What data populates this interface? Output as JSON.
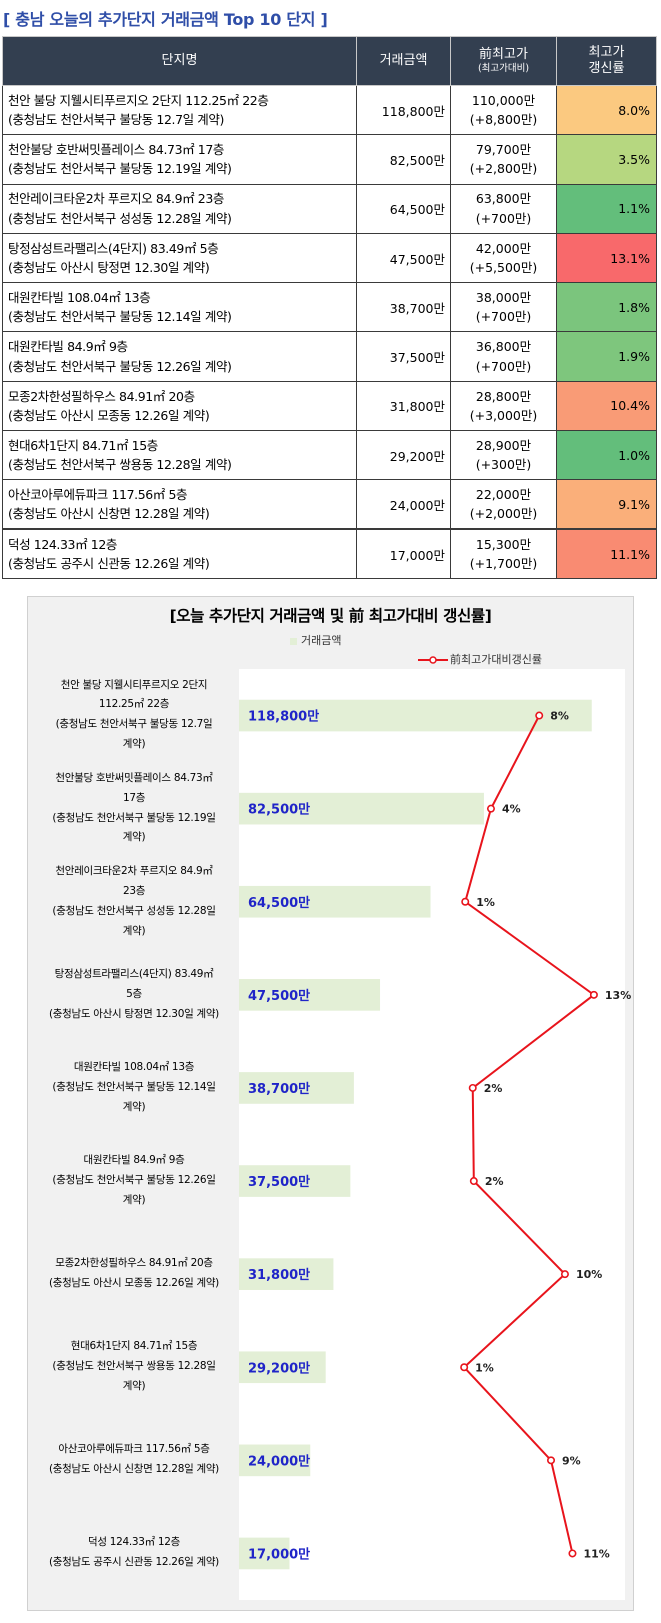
{
  "page_title": "[ 충남 오늘의 추가단지 거래금액 Top 10 단지 ]",
  "table": {
    "headers": {
      "name": "단지명",
      "price": "거래금액",
      "prev_line1": "前최고가",
      "prev_line2": "(최고가대비)",
      "rate_line1": "최고가",
      "rate_line2": "갱신률"
    },
    "rows": [
      {
        "name": "천안 불당 지웰시티푸르지오 2단지 112.25㎡ 22층",
        "location": "(충청남도 천안서북구 불당동 12.7일 계약)",
        "price": "118,800만",
        "prev": "110,000만",
        "diff": "(+8,800만)",
        "rate": "8.0%",
        "color": "#fbc980"
      },
      {
        "name": "천안불당 호반써밋플레이스 84.73㎡ 17층",
        "location": "(충청남도 천안서북구 불당동 12.19일 계약)",
        "price": "82,500만",
        "prev": "79,700만",
        "diff": "(+2,800만)",
        "rate": "3.5%",
        "color": "#b6d780"
      },
      {
        "name": "천안레이크타운2차 푸르지오 84.9㎡ 23층",
        "location": "(충청남도 천안서북구 성성동 12.28일 계약)",
        "price": "64,500만",
        "prev": "63,800만",
        "diff": "(+700만)",
        "rate": "1.1%",
        "color": "#63be7b"
      },
      {
        "name": "탕정삼성트라팰리스(4단지) 83.49㎡ 5층",
        "location": "(충청남도 아산시 탕정면 12.30일 계약)",
        "price": "47,500만",
        "prev": "42,000만",
        "diff": "(+5,500만)",
        "rate": "13.1%",
        "color": "#f8696b"
      },
      {
        "name": "대원칸타빌 108.04㎡ 13층",
        "location": "(충청남도 천안서북구 불당동 12.14일 계약)",
        "price": "38,700만",
        "prev": "38,000만",
        "diff": "(+700만)",
        "rate": "1.8%",
        "color": "#7bc57d"
      },
      {
        "name": "대원칸타빌 84.9㎡ 9층",
        "location": "(충청남도 천안서북구 불당동 12.26일 계약)",
        "price": "37,500만",
        "prev": "36,800만",
        "diff": "(+700만)",
        "rate": "1.9%",
        "color": "#7ec67d"
      },
      {
        "name": "모종2차한성필하우스 84.91㎡ 20층",
        "location": "(충청남도 아산시 모종동 12.26일 계약)",
        "price": "31,800만",
        "prev": "28,800만",
        "diff": "(+3,000만)",
        "rate": "10.4%",
        "color": "#f99b76"
      },
      {
        "name": "현대6차1단지 84.71㎡ 15층",
        "location": "(충청남도 천안서북구 쌍용동 12.28일 계약)",
        "price": "29,200만",
        "prev": "28,900만",
        "diff": "(+300만)",
        "rate": "1.0%",
        "color": "#63be7b"
      },
      {
        "name": "아산코아루에듀파크 117.56㎡ 5층",
        "location": "(충청남도 아산시 신창면 12.28일 계약)",
        "price": "24,000만",
        "prev": "22,000만",
        "diff": "(+2,000만)",
        "rate": "9.1%",
        "color": "#faaf7a"
      },
      {
        "name": "덕성 124.33㎡ 12층",
        "location": "(충청남도 공주시 신관동 12.26일 계약)",
        "price": "17,000만",
        "prev": "15,300만",
        "diff": "(+1,700만)",
        "rate": "11.1%",
        "color": "#f98b72"
      }
    ]
  },
  "colors": {
    "header_bg": "#333f50",
    "bar": "#e3efd6",
    "bar_label": "#1f24c8",
    "line": "#e8141c",
    "title": "#2f4ea8"
  },
  "chart_data": {
    "type": "bar",
    "orientation": "horizontal",
    "title": "[오늘 추가단지 거래금액  및 前 최고가대비 갱신률]",
    "legend": {
      "bar": "거래금액",
      "line": "前최고가대비갱신률"
    },
    "categories": [
      [
        "천안 불당 지웰시티푸르지오 2단지",
        "112.25㎡ 22층",
        "(충청남도 천안서북구 불당동 12.7일",
        "계약)"
      ],
      [
        "천안불당 호반써밋플레이스 84.73㎡",
        "17층",
        "(충청남도 천안서북구 불당동 12.19일",
        "계약)"
      ],
      [
        "천안레이크타운2차 푸르지오 84.9㎡",
        "23층",
        "(충청남도 천안서북구 성성동 12.28일",
        "계약)"
      ],
      [
        "탕정삼성트라팰리스(4단지) 83.49㎡",
        "5층",
        "(충청남도 아산시 탕정면 12.30일 계약)"
      ],
      [
        "대원칸타빌 108.04㎡ 13층",
        "(충청남도 천안서북구 불당동 12.14일",
        "계약)"
      ],
      [
        "대원칸타빌 84.9㎡ 9층",
        "(충청남도 천안서북구 불당동 12.26일",
        "계약)"
      ],
      [
        "모종2차한성필하우스 84.91㎡ 20층",
        "(충청남도 아산시 모종동 12.26일 계약)"
      ],
      [
        "현대6차1단지 84.71㎡ 15층",
        "(충청남도 천안서북구 쌍용동 12.28일",
        "계약)"
      ],
      [
        "아산코아루에듀파크 117.56㎡ 5층",
        "(충청남도 아산시 신창면 12.28일 계약)"
      ],
      [
        "덕성 124.33㎡ 12층",
        "(충청남도 공주시 신관동 12.26일 계약)"
      ]
    ],
    "series": [
      {
        "name": "거래금액",
        "type": "bar",
        "values": [
          118800,
          82500,
          64500,
          47500,
          38700,
          37500,
          31800,
          29200,
          24000,
          17000
        ],
        "labels": [
          "118,800만",
          "82,500만",
          "64,500만",
          "47,500만",
          "38,700만",
          "37,500만",
          "31,800만",
          "29,200만",
          "24,000만",
          "17,000만"
        ],
        "xlim": [
          0,
          130000
        ]
      },
      {
        "name": "前최고가대비갱신률",
        "type": "line",
        "values": [
          8.0,
          3.5,
          1.1,
          13.1,
          1.8,
          1.9,
          10.4,
          1.0,
          9.1,
          11.1
        ],
        "labels": [
          "8%",
          "4%",
          "1%",
          "13%",
          "2%",
          "2%",
          "10%",
          "1%",
          "9%",
          "11%"
        ],
        "xlim": [
          -20,
          16
        ]
      }
    ]
  }
}
